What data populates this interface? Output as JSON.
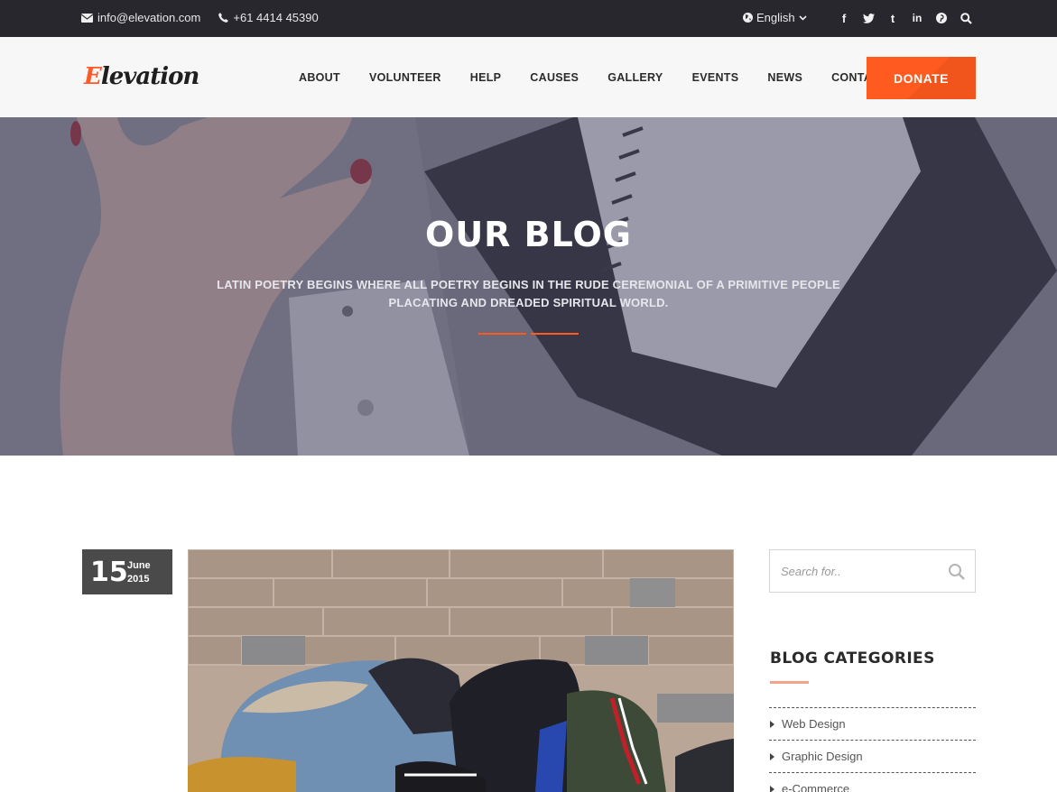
{
  "topbar": {
    "email": "info@elevation.com",
    "phone": "+61 4414 45390",
    "language": "English",
    "social": [
      {
        "name": "facebook-icon",
        "glyph": "f"
      },
      {
        "name": "twitter-icon",
        "glyph": "t"
      },
      {
        "name": "tumblr-icon",
        "glyph": "t"
      },
      {
        "name": "linkedin-icon",
        "glyph": "in"
      },
      {
        "name": "pinterest-icon",
        "glyph": "p"
      },
      {
        "name": "search-icon",
        "glyph": "search"
      }
    ]
  },
  "header": {
    "logo_first": "E",
    "logo_rest": "levation",
    "nav": [
      "ABOUT",
      "VOLUNTEER",
      "HELP",
      "CAUSES",
      "GALLERY",
      "EVENTS",
      "NEWS",
      "CONTACT"
    ],
    "donate_label": "DONATE"
  },
  "banner": {
    "title": "OUR BLOG",
    "subtitle_line1": "LATIN POETRY BEGINS WHERE ALL POETRY BEGINS IN THE RUDE CEREMONIAL OF A PRIMITIVE PEOPLE",
    "subtitle_line2": "PLACATING AND DREADED SPIRITUAL WORLD."
  },
  "post": {
    "day": "15",
    "month": "June",
    "year": "2015"
  },
  "sidebar": {
    "search_placeholder": "Search for..",
    "categories_title": "BLOG CATEGORIES",
    "categories": [
      "Web Design",
      "Graphic Design",
      "e-Commerce"
    ]
  },
  "colors": {
    "accent": "#ff5a1f",
    "topbar_bg": "#1e1e21",
    "header_bg": "#f7f7f7"
  }
}
